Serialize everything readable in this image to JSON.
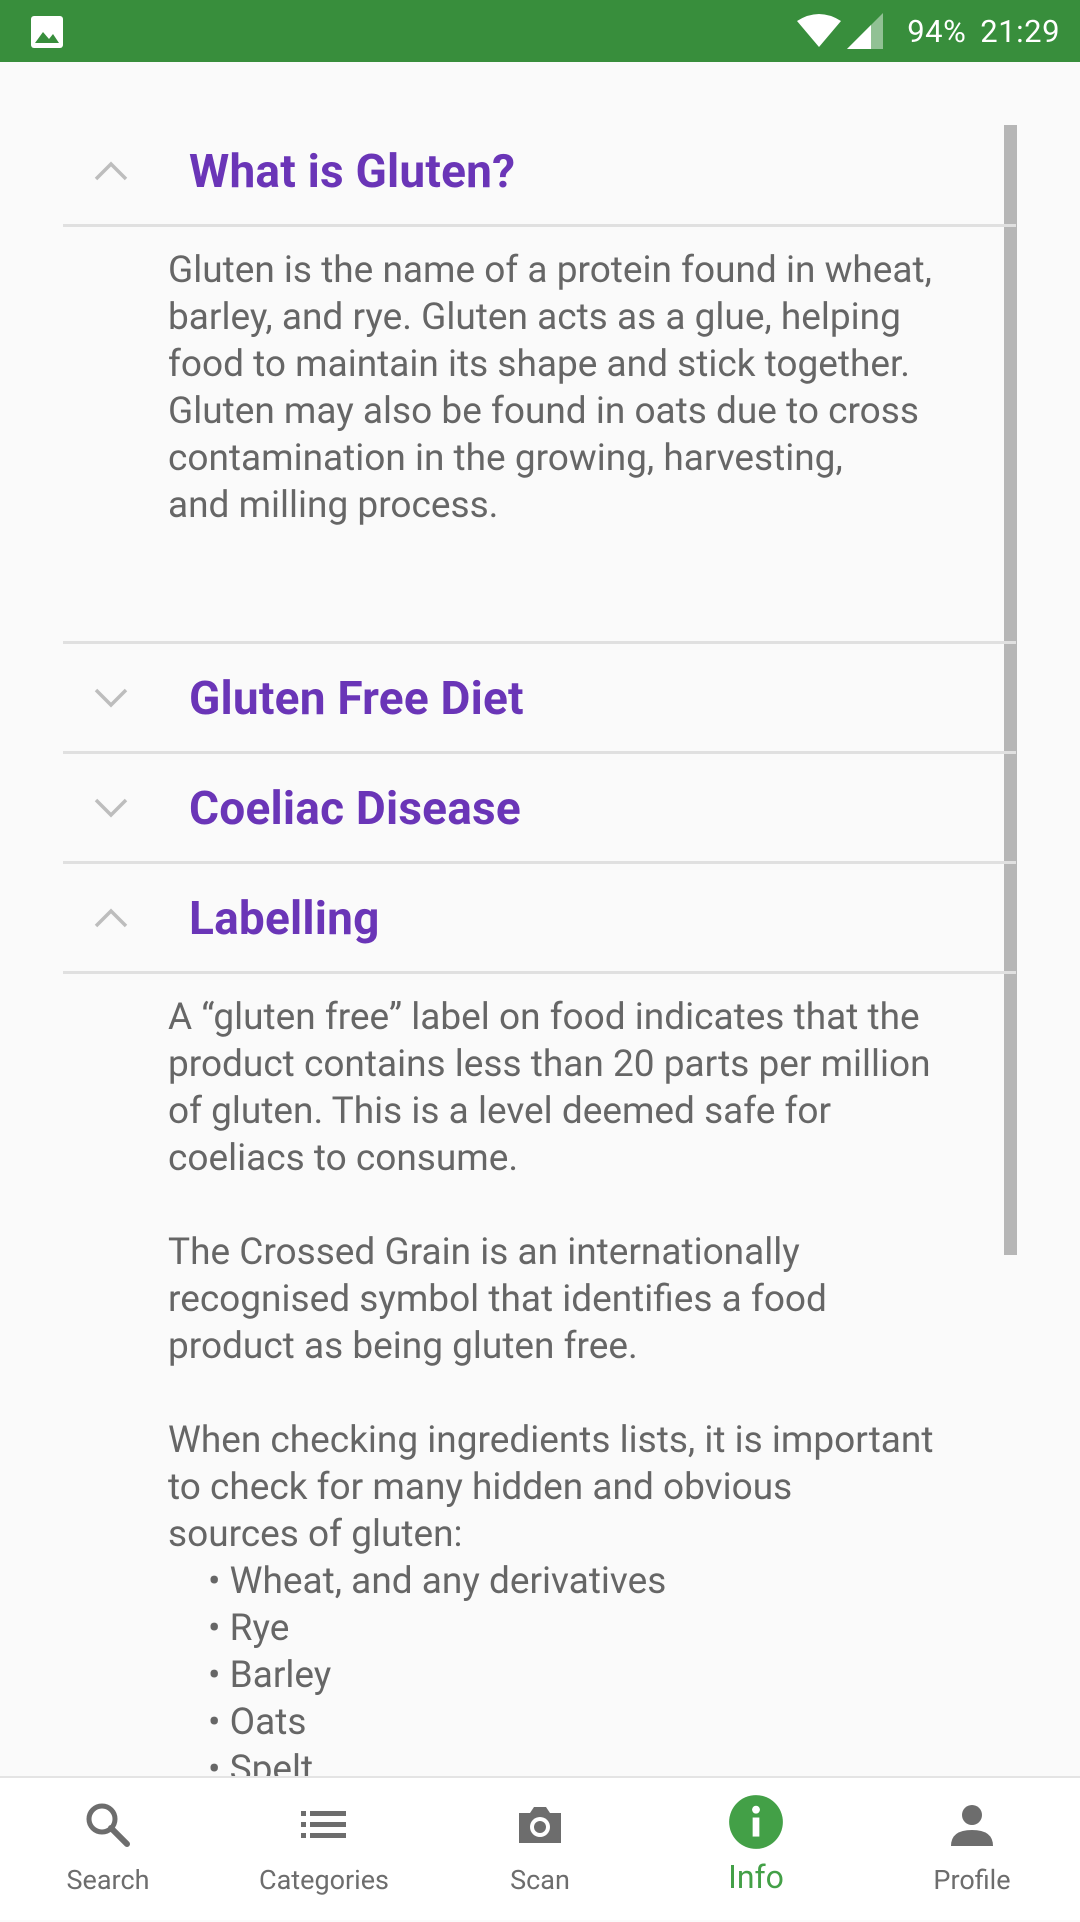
{
  "status_bar": {
    "battery": "94%",
    "time": "21:29",
    "icons": [
      "image-icon",
      "wifi-icon",
      "signal-icon"
    ]
  },
  "sections": [
    {
      "title": "What is Gluten?",
      "expanded": true,
      "body": "Gluten is the name of a protein found in wheat,\nbarley, and rye. Gluten acts as a glue, helping\nfood to maintain its shape and stick together.\nGluten may also be found in oats due to cross\ncontamination in the growing, harvesting,\nand milling process."
    },
    {
      "title": "Gluten Free Diet",
      "expanded": false
    },
    {
      "title": "Coeliac Disease",
      "expanded": false
    },
    {
      "title": "Labelling",
      "expanded": true,
      "paragraphs": [
        "A “gluten free” label on food indicates that the\nproduct contains less than 20 parts per million\nof gluten. This is a level deemed safe for\ncoeliacs to consume.",
        "The Crossed Grain is an internationally\nrecognised symbol that identifies a food\nproduct as being gluten free.",
        "When checking ingredients lists, it is important\nto check for many hidden and obvious\nsources of gluten:"
      ],
      "bullets": [
        "Wheat, and any derivatives",
        "Rye",
        "Barley",
        "Oats",
        "Spelt"
      ]
    }
  ],
  "bottom_nav": {
    "items": [
      {
        "label": "Search",
        "icon": "search-icon"
      },
      {
        "label": "Categories",
        "icon": "list-icon"
      },
      {
        "label": "Scan",
        "icon": "camera-icon"
      },
      {
        "label": "Info",
        "icon": "info-icon",
        "active": true
      },
      {
        "label": "Profile",
        "icon": "person-icon"
      }
    ]
  },
  "colors": {
    "status_bar": "#388e3c",
    "section_title": "#6a35b7",
    "active_nav": "#43a047",
    "inactive_nav": "#6d6d6d",
    "body_text": "#666666"
  }
}
